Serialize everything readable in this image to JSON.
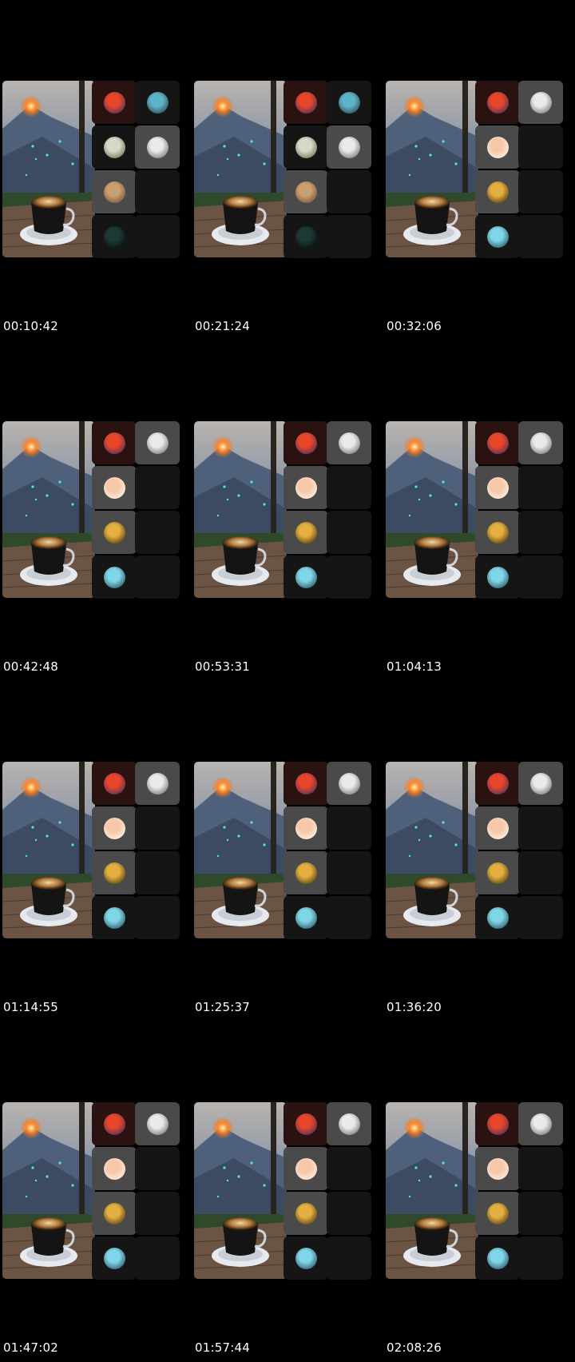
{
  "frames": [
    {
      "timestamp": "00:10:42",
      "layout": "a"
    },
    {
      "timestamp": "00:21:24",
      "layout": "a"
    },
    {
      "timestamp": "00:32:06",
      "layout": "b"
    },
    {
      "timestamp": "00:42:48",
      "layout": "b"
    },
    {
      "timestamp": "00:53:31",
      "layout": "b"
    },
    {
      "timestamp": "01:04:13",
      "layout": "b"
    },
    {
      "timestamp": "01:14:55",
      "layout": "b"
    },
    {
      "timestamp": "01:25:37",
      "layout": "b"
    },
    {
      "timestamp": "01:36:20",
      "layout": "b"
    },
    {
      "timestamp": "01:47:02",
      "layout": "b"
    },
    {
      "timestamp": "01:57:44",
      "layout": "b"
    },
    {
      "timestamp": "02:08:26",
      "layout": "b"
    }
  ],
  "avatars": {
    "sunset-warrior": [
      "#e8462a",
      "#1c2a6b"
    ],
    "blue-hooded": [
      "#5fb3c9",
      "#1b2b2e"
    ],
    "old-man-bw": [
      "#eaeaea",
      "#555555"
    ],
    "statue": [
      "#d8d8c8",
      "#4b5a3a"
    ],
    "baby-face": [
      "#f6c8a8",
      "#ffffff"
    ],
    "vintage-box": [
      "#c9a070",
      "#5a4030"
    ],
    "dark-hooded": [
      "#1d3a36",
      "#050505"
    ],
    "gold-emblem": [
      "#e3b040",
      "#2a1c06"
    ],
    "cyan-figure": [
      "#7fd6e8",
      "#173038"
    ]
  }
}
